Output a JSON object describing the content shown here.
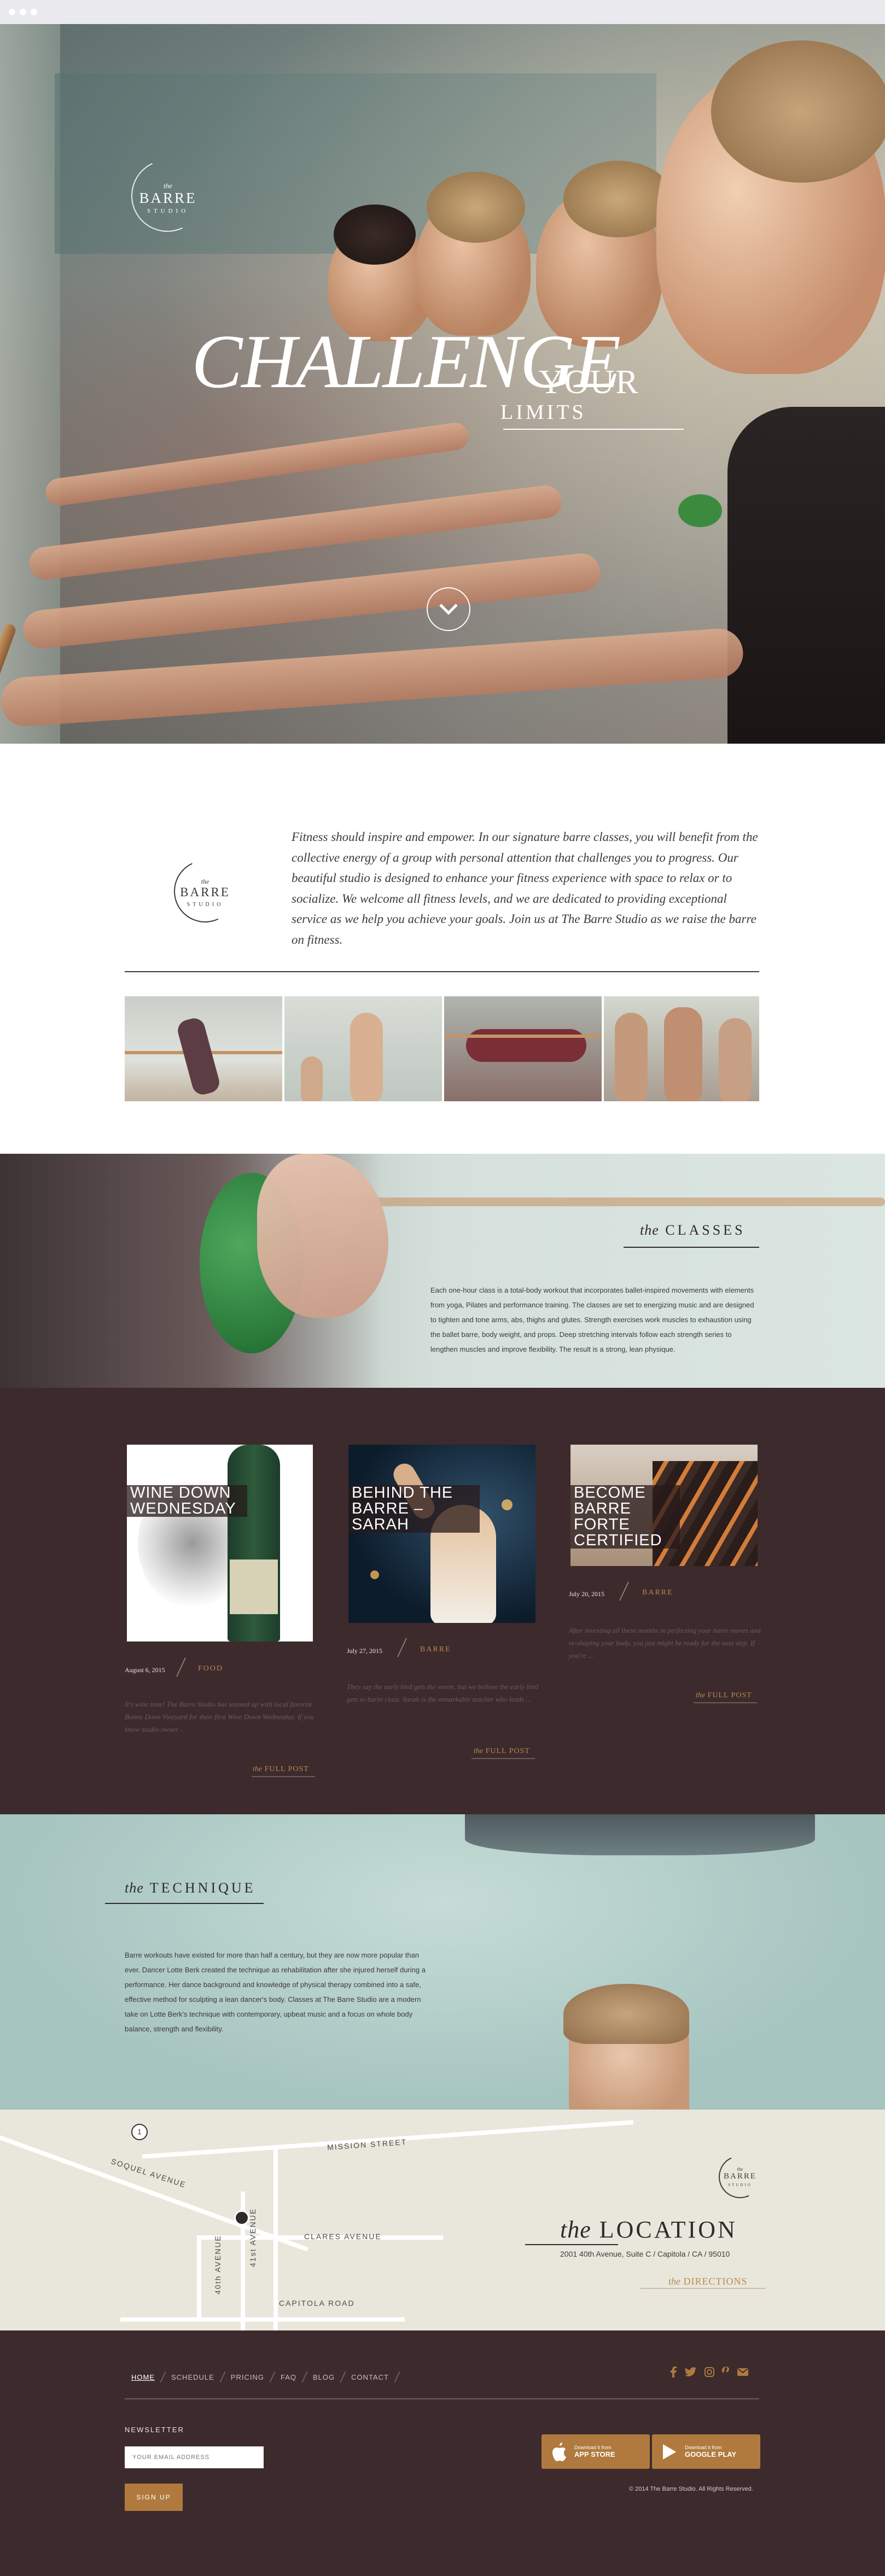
{
  "hero": {
    "logo": {
      "the": "the",
      "name": "BARRE",
      "sub": "STUDIO"
    },
    "title_big": "CHALLENGE",
    "title_your": "YOUR",
    "title_limits": "LIMITS"
  },
  "intro": {
    "logo": {
      "the": "the",
      "name": "BARRE",
      "sub": "STUDIO"
    },
    "text": "Fitness should inspire and empower. In our signature barre classes, you will benefit from the collective energy of a group with personal attention that challenges you to progress. Our beautiful studio is designed to enhance your fitness experience with space to relax or to socialize. We welcome all fitness levels, and we are dedicated to providing exceptional service as we help you achieve your goals. Join us at The Barre Studio as we raise the barre on fitness."
  },
  "classes": {
    "the": "the",
    "title": "CLASSES",
    "body": "Each one-hour class is a total-body workout that incorporates ballet-inspired movements with elements from yoga, Pilates and performance training. The classes are set to energizing music and are designed to tighten and tone arms, abs, thighs and glutes. Strength exercises work muscles to exhaustion using the ballet barre, body weight, and props. Deep stretching intervals follow each strength series to lengthen muscles and improve flexibility. The result is a strong, lean physique."
  },
  "blog": {
    "posts": [
      {
        "title": "WINE DOWN WEDNESDAY",
        "date": "August 6, 2015",
        "category": "FOOD",
        "excerpt": "It's wine time! The Barre Studio has teamed up with local favorite Bonny Doon Vineyard for their first Wine Down Wednesday. If you know studio owner ...",
        "link_the": "the",
        "link": "FULL POST"
      },
      {
        "title": "BEHIND THE BARRE – SARAH",
        "date": "July 27, 2015",
        "category": "BARRE",
        "excerpt": "They say the early bird gets the worm, but we believe the early bird gets to barre class. Sarah is the remarkable teacher who leads ...",
        "link_the": "the",
        "link": "FULL POST"
      },
      {
        "title": "BECOME BARRE FORTE CERTIFIED",
        "date": "July 20, 2015",
        "category": "BARRE",
        "excerpt": "After investing all these months in perfecting your barre moves and re-shaping your body, you just might be ready for the next step. If you're ...",
        "link_the": "the",
        "link": "FULL POST"
      }
    ]
  },
  "technique": {
    "the": "the",
    "title": "TECHNIQUE",
    "body": "Barre workouts have existed for more than half a century, but they are now more popular than ever. Dancer Lotte Berk created the technique as rehabilitation after she injured herself during a performance. Her dance background and knowledge of physical therapy combined into a safe, effective method for sculpting a lean dancer's body. Classes at The Barre Studio are a modern take on Lotte Berk's technique with contemporary, upbeat music and a focus on whole body balance, strength and flexibility."
  },
  "location": {
    "map": {
      "route_number": "1",
      "streets": [
        "SOQUEL AVENUE",
        "MISSION STREET",
        "CLARES AVENUE",
        "CAPITOLA ROAD"
      ],
      "avenue_40th": "40th AVENUE",
      "avenue_41st": "41st AVENUE"
    },
    "logo": {
      "the": "the",
      "name": "BARRE",
      "sub": "STUDIO"
    },
    "the": "the",
    "title": "LOCATION",
    "address": "2001 40th Avenue, Suite C  /  Capitola / CA / 95010",
    "directions_the": "the",
    "directions": "DIRECTIONS"
  },
  "footer": {
    "nav": [
      "HOME",
      "SCHEDULE",
      "PRICING",
      "FAQ",
      "BLOG",
      "CONTACT"
    ],
    "social_icons": [
      "facebook-icon",
      "twitter-icon",
      "instagram-icon",
      "pinterest-icon",
      "email-icon"
    ],
    "newsletter_label": "NEWSLETTER",
    "email_placeholder": "YOUR EMAIL ADDRESS",
    "signup": "SIGN UP",
    "app_store": {
      "small": "Download it from",
      "big": "APP STORE"
    },
    "google_play": {
      "small": "Download it from",
      "big": "GOOGLE PLAY"
    },
    "copyright": "© 2014 The Barre Studio. All Rights Reserved."
  },
  "colors": {
    "accent_gold": "#b98a4e",
    "dark_plum": "#3c2a2d",
    "mint": "#a9c7c3",
    "sand": "#e9e7dc"
  }
}
